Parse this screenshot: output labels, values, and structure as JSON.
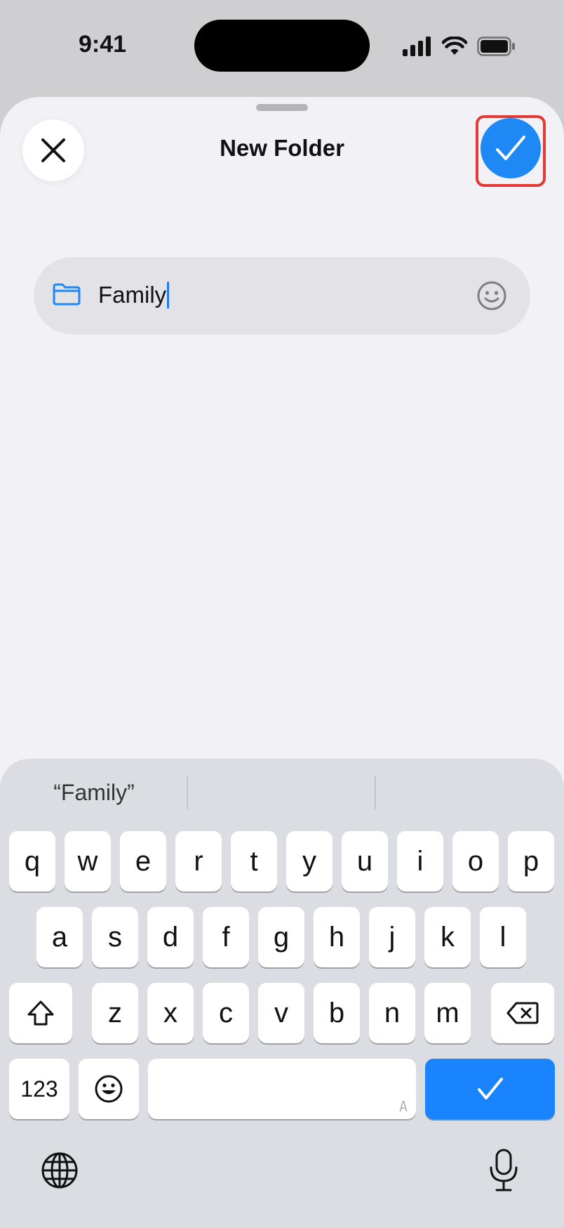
{
  "status_bar": {
    "time": "9:41",
    "icons": [
      "cellular-signal-icon",
      "wifi-icon",
      "battery-icon"
    ]
  },
  "header": {
    "title": "New Folder",
    "close_icon": "close-icon",
    "done_icon": "checkmark-icon"
  },
  "name_field": {
    "value": "Family",
    "leading_icon": "folder-icon",
    "trailing_icon": "emoji-icon"
  },
  "keyboard": {
    "suggestions": [
      "“Family”",
      "",
      ""
    ],
    "row1": [
      "q",
      "w",
      "e",
      "r",
      "t",
      "y",
      "u",
      "i",
      "o",
      "p"
    ],
    "row2": [
      "a",
      "s",
      "d",
      "f",
      "g",
      "h",
      "j",
      "k",
      "l"
    ],
    "row3": [
      "z",
      "x",
      "c",
      "v",
      "b",
      "n",
      "m"
    ],
    "numbers_key": "123",
    "space_hint": "A",
    "icons": [
      "shift-icon",
      "delete-icon",
      "emoji-key-icon",
      "return-checkmark-icon",
      "globe-icon",
      "microphone-icon"
    ]
  },
  "colors": {
    "accent": "#1e88f5",
    "highlight": "#e53935",
    "sheet": "#f1f1f6",
    "keyboard": "#dcdde2"
  }
}
